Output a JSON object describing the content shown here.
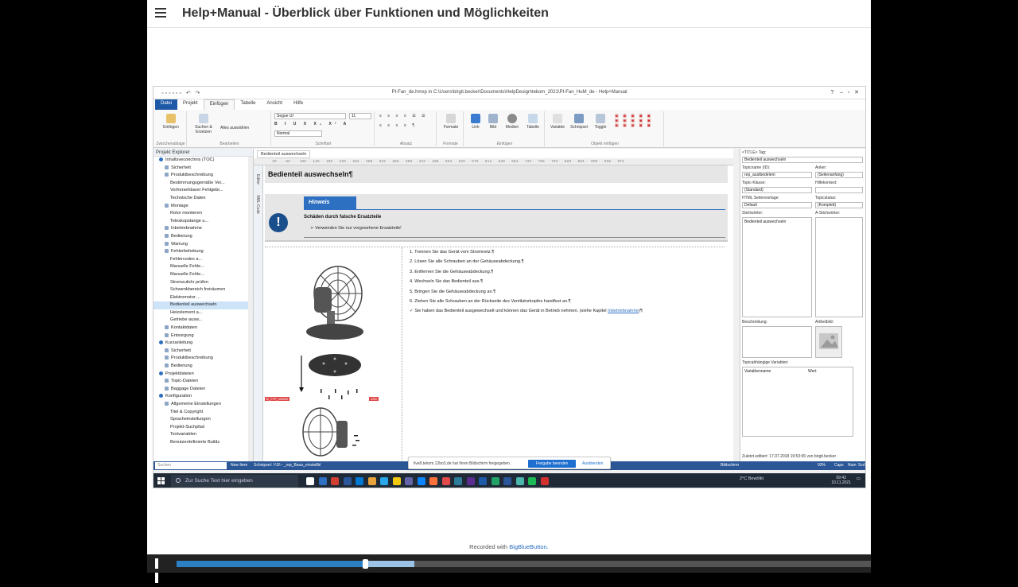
{
  "header": {
    "title": "Help+Manual - Überblick über Funktionen und Möglichkeiten"
  },
  "app": {
    "window_path": "PI-Fan_de.hmxp in C:\\Users\\birgit.becker\\Documents\\HelpDesign\\tekom_2021\\PI-Fan_HuM_de - Help+Manual",
    "ribbon_tabs": [
      "Datei",
      "Projekt",
      "Einfügen",
      "Tabelle",
      "Ansicht",
      "Hilfe"
    ],
    "ribbon_groups": [
      "Zwischenablage",
      "Bearbeiten",
      "Schriftart",
      "Absatz",
      "Formate",
      "Einfügen",
      "Objekt einfügen"
    ],
    "ribbon_buttons": {
      "paste": "Einfügen",
      "find": "Suchen & Ersetzen",
      "select_all": "Alles auswählen",
      "font": "Segoe UI",
      "font_size": "11",
      "style": "Normal",
      "formats": "Formate",
      "link": "Link",
      "image": "Bild",
      "media": "Medien",
      "table": "Tabelle",
      "variable": "Variable",
      "snippet": "Schnipsel",
      "toggle": "Toggle"
    }
  },
  "explorer": {
    "title": "Projekt Explorer",
    "items": [
      {
        "label": "Inhaltsverzeichnis (TOC)",
        "kind": "blue",
        "indent": 1
      },
      {
        "label": "Sicherheit",
        "kind": "folder",
        "indent": 2
      },
      {
        "label": "Produktbeschreibung",
        "kind": "folder",
        "indent": 2
      },
      {
        "label": "Bestimmungsgemäße Ver...",
        "kind": "page",
        "indent": 3
      },
      {
        "label": "Vorhersehbarer Fehlgebr...",
        "kind": "page",
        "indent": 3
      },
      {
        "label": "Technische Daten",
        "kind": "page",
        "indent": 3
      },
      {
        "label": "Montage",
        "kind": "folder",
        "indent": 2
      },
      {
        "label": "Rotor montieren",
        "kind": "page",
        "indent": 3
      },
      {
        "label": "Teleskopstange u...",
        "kind": "page",
        "indent": 3
      },
      {
        "label": "Inbetriebnahme",
        "kind": "folder",
        "indent": 2
      },
      {
        "label": "Bedienung",
        "kind": "folder",
        "indent": 2
      },
      {
        "label": "Wartung",
        "kind": "folder",
        "indent": 2
      },
      {
        "label": "Fehlerbehebung",
        "kind": "folder",
        "indent": 2
      },
      {
        "label": "Fehlercodes a...",
        "kind": "page",
        "indent": 3
      },
      {
        "label": "Manuelle Fehle...",
        "kind": "page",
        "indent": 3
      },
      {
        "label": "Manuelle Fehle...",
        "kind": "page",
        "indent": 3
      },
      {
        "label": "Stromzufuhr prüfen",
        "kind": "page",
        "indent": 3
      },
      {
        "label": "Schwenkbereich freiräumen",
        "kind": "page",
        "indent": 3
      },
      {
        "label": "Elektromotor ...",
        "kind": "page",
        "indent": 3
      },
      {
        "label": "Bedienteil auswechseln",
        "kind": "page",
        "indent": 3,
        "selected": true
      },
      {
        "label": "Heizelement a...",
        "kind": "page",
        "indent": 3
      },
      {
        "label": "Getriebe ausw...",
        "kind": "page",
        "indent": 3
      },
      {
        "label": "Kontaktdaten",
        "kind": "folder",
        "indent": 2
      },
      {
        "label": "Entsorgung",
        "kind": "folder",
        "indent": 2
      },
      {
        "label": "Kurzanleitung",
        "kind": "blue",
        "indent": 1
      },
      {
        "label": "Sicherheit",
        "kind": "folder",
        "indent": 2
      },
      {
        "label": "Produktbeschreibung",
        "kind": "folder",
        "indent": 2
      },
      {
        "label": "Bedienung",
        "kind": "folder",
        "indent": 2
      },
      {
        "label": "Projektdateien",
        "kind": "blue",
        "indent": 1
      },
      {
        "label": "Topic-Dateien",
        "kind": "folder",
        "indent": 2
      },
      {
        "label": "Baggage Dateien",
        "kind": "folder",
        "indent": 2
      },
      {
        "label": "Konfiguration",
        "kind": "blue",
        "indent": 1
      },
      {
        "label": "Allgemeine Einstellungen",
        "kind": "folder",
        "indent": 2
      },
      {
        "label": "Titel & Copyright",
        "kind": "page",
        "indent": 3
      },
      {
        "label": "Spracheinstellungen",
        "kind": "page",
        "indent": 3
      },
      {
        "label": "Projekt-Suchpfad",
        "kind": "page",
        "indent": 3
      },
      {
        "label": "Textvariablen",
        "kind": "page",
        "indent": 3
      },
      {
        "label": "Benutzerdefinierte Builds",
        "kind": "page",
        "indent": 3
      }
    ],
    "search_placeholder": "Suchen"
  },
  "editor": {
    "doc_tab": "Bedienteil auswechseln",
    "ruler": "· 20 · · · 60 · · · 100 · · 140 · · 180 · · 220 · · 252 · · 268 · · 316 · · 356 · · 396 · · 422 · · 468 · · 504 · · 540 · · 576 · · 612 · · 648 · · 684 · · 720 · · 756 · · 792 · · 828 · · 864 · · 900 · · 936 · · 972",
    "side_tabs": [
      "Editor",
      "XML-Code"
    ],
    "heading": "Bedienteil auswechseln¶",
    "hint": {
      "label": "Hinweis",
      "title": "Schäden durch falsche Ersatzteile",
      "bullet": "➢ Verwenden Sie nur vorgesehene Ersatzteile!"
    },
    "fan_labels": [
      "B_TYP_1050/0",
      "1/60"
    ],
    "steps": [
      "1.  Trennen Sie das Gerät vom Stromnetz.¶",
      "2.  Lösen Sie alle Schrauben an der Gehäuseabdeckung.¶",
      "3.  Entfernen Sie die Gehäuseabdeckung.¶",
      "4.  Wechseln Sie das Bedienteil aus.¶",
      "5.  Bringen Sie die Gehäuseabdeckung an.¶",
      "6.  Ziehen Sie alle Schrauben an der Rückseite des Ventilatorkopfes handfest an.¶"
    ],
    "result": "✓ Sie haben das Bedienteil ausgewechselt und können das Gerät in Betrieb nehmen. (siehe Kapitel ",
    "result_link": "Inbetriebnahme",
    "result_end": ")¶"
  },
  "props": {
    "title_tag": "<TITLE> Tag:",
    "title_value": "Bedienteil auswechseln",
    "topic_name_label": "Topicname (ID):",
    "topic_name_value": "rep_austbedelem",
    "anchor_label": "Anker:",
    "anchor_value": "(Seitenanfang)",
    "topic_class_label": "Topic-Klasse:",
    "topic_class_value": "(Standard)",
    "help_context_label": "Hilfekontext:",
    "html_template_label": "HTML Seitenvorlage:",
    "html_template_value": "Default",
    "topic_status_label": "Topicstatus:",
    "topic_status_value": "(Komplett)",
    "keywords_label": "Stichwörter:",
    "keywords_value": "Bedienteil auswechseln",
    "a_keywords_label": "A-Stichwörter:",
    "description_label": "Beschreibung:",
    "article_image_label": "Artikelbild:",
    "topic_vars_label": "Topicabhängige Variablen:",
    "var_name_col": "Variablenname",
    "var_value_col": "Wert",
    "last_edited": "Zuletzt editiert: 17.07.2018 19:53:06 von birgit.becker"
  },
  "status": {
    "new_item": "New Item",
    "snippet": "Schnipsel: I:\\S\\~ _rep_Bauu_einstellbl",
    "screen": "Bildschirm",
    "zoom": "93%",
    "caps": "Caps",
    "num": "Num",
    "scrl": "Scrl"
  },
  "share": {
    "text": "live8.tekom.12bo3.de hat Ihren Bildschirm freigegeben.",
    "stop": "Freigabe beenden",
    "hide": "Ausblenden"
  },
  "taskbar": {
    "search": "Zur Suche Text hier eingeben",
    "weather": "2°C  Bewölkt",
    "time": "09:42",
    "date": "10.11.2021",
    "icon_colors": [
      "#ffffff",
      "#2d6fc0",
      "#d23f31",
      "#2b579a",
      "#0078d4",
      "#e8a33c",
      "#28a8ea",
      "#f2c811",
      "#6264a7",
      "#0a84ff",
      "#ff7139",
      "#e04a4a",
      "#2d7d9a",
      "#5c2d91",
      "#1e5aa8",
      "#21a366",
      "#2b579a",
      "#4db6ac",
      "#1db954",
      "#d32f2f"
    ]
  },
  "footer": {
    "recorded_with": "Recorded with",
    "brand": "BigBlueButton."
  },
  "playback": {
    "played_fraction": 0.271,
    "buffered_fraction": 0.342,
    "accent": "#2b7fc3"
  }
}
